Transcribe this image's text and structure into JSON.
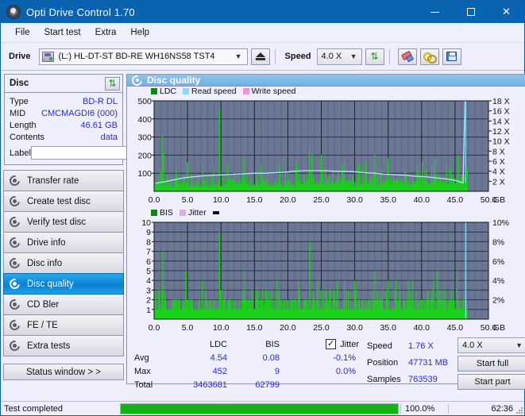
{
  "window": {
    "title": "Opti Drive Control 1.70",
    "icon": "disc-icon",
    "minimize": "minimize-icon",
    "maximize": "maximize-icon",
    "close": "close-icon"
  },
  "menu": {
    "items": [
      {
        "label": "File"
      },
      {
        "label": "Start test"
      },
      {
        "label": "Extra"
      },
      {
        "label": "Help"
      }
    ]
  },
  "toolbar": {
    "drive_label": "Drive",
    "drive_value": "(L:)  HL-DT-ST BD-RE  WH16NS58 TST4",
    "drive_icon": "drive-icon",
    "eject_icon": "eject-icon",
    "speed_label": "Speed",
    "speed_value": "4.0 X",
    "refresh_icon": "refresh-icon",
    "eraser_icon": "eraser-icon",
    "keys_icon": "keys-icon",
    "save_icon": "save-icon",
    "chevron": "⌄"
  },
  "disc_panel": {
    "title": "Disc",
    "refresh_icon": "refresh-icon",
    "rows": [
      {
        "key": "Type",
        "value": "BD-R DL"
      },
      {
        "key": "MID",
        "value": "CMCMAGDI6 (000)"
      },
      {
        "key": "Length",
        "value": "46.61 GB"
      },
      {
        "key": "Contents",
        "value": "data"
      }
    ],
    "label_key": "Label",
    "label_value": "",
    "label_placeholder": "",
    "label_button_icon": "disc-icon"
  },
  "sidebar": {
    "items": [
      {
        "label": "Transfer rate",
        "icon": "disc-icon",
        "active": false
      },
      {
        "label": "Create test disc",
        "icon": "disc-icon",
        "active": false
      },
      {
        "label": "Verify test disc",
        "icon": "disc-icon",
        "active": false
      },
      {
        "label": "Drive info",
        "icon": "disc-icon",
        "active": false
      },
      {
        "label": "Disc info",
        "icon": "disc-icon",
        "active": false
      },
      {
        "label": "Disc quality",
        "icon": "disc-icon",
        "active": true
      },
      {
        "label": "CD Bler",
        "icon": "disc-icon",
        "active": false
      },
      {
        "label": "FE / TE",
        "icon": "disc-icon",
        "active": false
      },
      {
        "label": "Extra tests",
        "icon": "disc-icon",
        "active": false
      }
    ],
    "status_button": "Status window > >"
  },
  "main": {
    "title": "Disc quality",
    "icon": "disc-icon"
  },
  "chart_data": [
    {
      "type": "line",
      "id": "ldc-chart",
      "title": "",
      "xlabel": "GB",
      "ylabel": "",
      "xlim": [
        0,
        50
      ],
      "ylim": [
        0,
        500
      ],
      "y2lim": [
        0,
        18
      ],
      "xticks": [
        "0.0",
        "5.0",
        "10.0",
        "15.0",
        "20.0",
        "25.0",
        "30.0",
        "35.0",
        "40.0",
        "45.0",
        "50.0"
      ],
      "yticks": [
        "100",
        "200",
        "300",
        "400",
        "500"
      ],
      "y2ticks": [
        "2 X",
        "4 X",
        "6 X",
        "8 X",
        "10 X",
        "12 X",
        "14 X",
        "16 X",
        "18 X"
      ],
      "grid": true,
      "legend_position": "top",
      "legend": [
        {
          "name": "LDC",
          "color": "#0a8c0a"
        },
        {
          "name": "Read speed",
          "color": "#8fd8f5"
        },
        {
          "name": "Write speed",
          "color": "#f58fe0"
        }
      ],
      "series": [
        {
          "name": "Read speed",
          "color": "#8fd8f5",
          "x": [
            0.2,
            1.5,
            3.0,
            4.5,
            6.0,
            7.5,
            9.0,
            10.5,
            12.0,
            13.5,
            15.0,
            16.5,
            18.0,
            19.5,
            21.0,
            22.5,
            24.0,
            25.5,
            27.0,
            28.5,
            30.0,
            31.5,
            33.0,
            34.5,
            36.0,
            37.5,
            39.0,
            40.5,
            42.0,
            43.5,
            45.0,
            46.2,
            46.5
          ],
          "values": [
            1.6,
            1.9,
            2.3,
            2.7,
            2.9,
            3.1,
            3.2,
            3.3,
            3.4,
            3.5,
            3.6,
            3.6,
            3.7,
            3.8,
            4.0,
            4.1,
            4.1,
            4.1,
            4.0,
            4.0,
            3.9,
            3.7,
            3.6,
            3.4,
            3.3,
            3.2,
            3.0,
            2.9,
            2.7,
            2.5,
            2.2,
            1.7,
            18.0
          ],
          "unit": "X"
        },
        {
          "name": "LDC",
          "color": "#19d119",
          "note": "dense error spike bars spanning 0 to 47 GB; baseline ~30-60, typical spikes 100-200, notable peaks listed",
          "peaks": [
            {
              "x": 1.2,
              "y": 305
            },
            {
              "x": 1.4,
              "y": 215
            },
            {
              "x": 5.0,
              "y": 160
            },
            {
              "x": 7.3,
              "y": 155
            },
            {
              "x": 9.8,
              "y": 452
            },
            {
              "x": 11.0,
              "y": 155
            },
            {
              "x": 13.4,
              "y": 185
            },
            {
              "x": 16.0,
              "y": 140
            },
            {
              "x": 21.2,
              "y": 160
            },
            {
              "x": 23.2,
              "y": 240
            },
            {
              "x": 23.6,
              "y": 205
            },
            {
              "x": 25.0,
              "y": 200
            },
            {
              "x": 28.1,
              "y": 150
            },
            {
              "x": 33.0,
              "y": 205
            },
            {
              "x": 35.0,
              "y": 160
            },
            {
              "x": 40.1,
              "y": 160
            },
            {
              "x": 42.0,
              "y": 180
            },
            {
              "x": 45.5,
              "y": 160
            },
            {
              "x": 46.6,
              "y": 180
            }
          ]
        }
      ]
    },
    {
      "type": "bar",
      "id": "bis-chart",
      "title": "",
      "xlabel": "GB",
      "ylabel": "",
      "xlim": [
        0,
        50
      ],
      "ylim": [
        0,
        10
      ],
      "y2lim": [
        0,
        10
      ],
      "xticks": [
        "0.0",
        "5.0",
        "10.0",
        "15.0",
        "20.0",
        "25.0",
        "30.0",
        "35.0",
        "40.0",
        "45.0",
        "50.0"
      ],
      "yticks": [
        "1",
        "2",
        "3",
        "4",
        "5",
        "6",
        "7",
        "8",
        "9",
        "10"
      ],
      "y2ticks": [
        "2%",
        "4%",
        "6%",
        "8%",
        "10%"
      ],
      "grid": true,
      "legend_position": "top",
      "legend": [
        {
          "name": "BIS",
          "color": "#0a8c0a"
        },
        {
          "name": "Jitter",
          "color": "#d8b0e0"
        }
      ],
      "series": [
        {
          "name": "BIS",
          "color": "#19d119",
          "note": "dense bars spanning 0 to 47 GB with baseline ~1-2, frequent 3, occasional higher peaks",
          "peaks": [
            {
              "x": 1.3,
              "y": 7
            },
            {
              "x": 4.8,
              "y": 5
            },
            {
              "x": 9.8,
              "y": 9
            },
            {
              "x": 13.5,
              "y": 5
            },
            {
              "x": 18.4,
              "y": 4
            },
            {
              "x": 21.6,
              "y": 4
            },
            {
              "x": 23.3,
              "y": 8
            },
            {
              "x": 24.4,
              "y": 4
            },
            {
              "x": 27.4,
              "y": 4
            },
            {
              "x": 33.0,
              "y": 5
            },
            {
              "x": 35.0,
              "y": 4
            },
            {
              "x": 41.8,
              "y": 4
            },
            {
              "x": 42.4,
              "y": 5
            },
            {
              "x": 45.3,
              "y": 5
            }
          ]
        }
      ]
    }
  ],
  "stats": {
    "headers": [
      "",
      "LDC",
      "BIS",
      ""
    ],
    "jitter_checkbox": {
      "label": "Jitter",
      "checked": true,
      "check_glyph": "✓"
    },
    "rows": [
      {
        "label": "Avg",
        "ldc": "4.54",
        "bis": "0.08",
        "jitter": "-0.1%"
      },
      {
        "label": "Max",
        "ldc": "452",
        "bis": "9",
        "jitter": "0.0%"
      },
      {
        "label": "Total",
        "ldc": "3463681",
        "bis": "62799",
        "jitter": ""
      }
    ],
    "info": [
      {
        "label": "Speed",
        "value": "1.76 X"
      },
      {
        "label": "Position",
        "value": "47731 MB"
      },
      {
        "label": "Samples",
        "value": "763539"
      }
    ],
    "speed_select": "4.0 X",
    "start_full": "Start full",
    "start_part": "Start part"
  },
  "statusbar": {
    "message": "Test completed",
    "progress_percent": 100,
    "progress_text": "100.0%",
    "elapsed": "62:36"
  },
  "colors": {
    "titlebar": "#0a63b0",
    "accent": "#0a7fd0",
    "plot_bg": "#6b7794",
    "grid": "#1b2230",
    "green": "#19d119",
    "cyan": "#8fd8f5",
    "pink": "#f58fe0",
    "value_text": "#2b2bd8",
    "progress_fill": "#10b510"
  }
}
